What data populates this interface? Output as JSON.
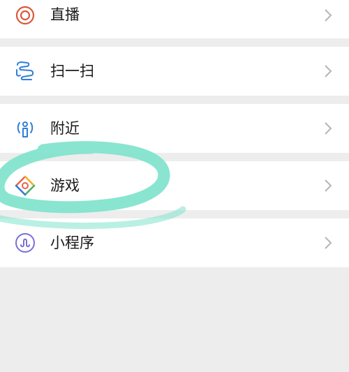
{
  "menu": {
    "items": [
      {
        "label": "直播",
        "icon": "live-icon"
      },
      {
        "label": "扫一扫",
        "icon": "scan-icon"
      },
      {
        "label": "附近",
        "icon": "nearby-icon"
      },
      {
        "label": "游戏",
        "icon": "game-icon"
      },
      {
        "label": "小程序",
        "icon": "mini-program-icon"
      }
    ]
  },
  "colors": {
    "background": "#ededed",
    "row": "#ffffff",
    "live_icon": "#d9583b",
    "scan_icon": "#2f7fd8",
    "nearby_icon": "#2f7fd8",
    "mini_program_icon": "#7a6fd8",
    "highlight_stroke": "#7fe3cc"
  }
}
